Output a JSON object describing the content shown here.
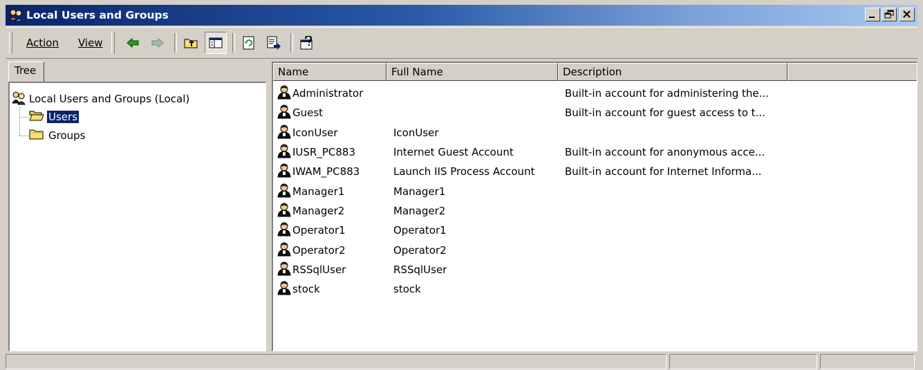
{
  "window": {
    "title": "Local Users and Groups",
    "controls": {
      "minimize": "_",
      "restore": "ø",
      "close": "×"
    }
  },
  "menu": {
    "action": "Action",
    "view": "View"
  },
  "toolbar": {
    "buttons": [
      "back-icon",
      "forward-icon",
      "up-folder-icon",
      "show-hide-tree-icon",
      "refresh-icon",
      "export-list-icon",
      "help-icon"
    ]
  },
  "tree": {
    "tab_label": "Tree",
    "root": "Local Users and Groups (Local)",
    "children": [
      {
        "label": "Users",
        "selected": true
      },
      {
        "label": "Groups",
        "selected": false
      }
    ]
  },
  "list": {
    "columns": [
      "Name",
      "Full Name",
      "Description",
      ""
    ],
    "rows": [
      {
        "name": "Administrator",
        "full_name": "",
        "description": "Built-in account for administering the..."
      },
      {
        "name": "Guest",
        "full_name": "",
        "description": "Built-in account for guest access to t..."
      },
      {
        "name": "IconUser",
        "full_name": "IconUser",
        "description": ""
      },
      {
        "name": "IUSR_PC883",
        "full_name": "Internet Guest Account",
        "description": "Built-in account for anonymous acce..."
      },
      {
        "name": "IWAM_PC883",
        "full_name": "Launch IIS Process Account",
        "description": "Built-in account for Internet Informa..."
      },
      {
        "name": "Manager1",
        "full_name": "Manager1",
        "description": ""
      },
      {
        "name": "Manager2",
        "full_name": "Manager2",
        "description": ""
      },
      {
        "name": "Operator1",
        "full_name": "Operator1",
        "description": ""
      },
      {
        "name": "Operator2",
        "full_name": "Operator2",
        "description": ""
      },
      {
        "name": "RSSqlUser",
        "full_name": "RSSqlUser",
        "description": ""
      },
      {
        "name": "stock",
        "full_name": "stock",
        "description": ""
      }
    ]
  },
  "colors": {
    "titlebar_start": "#0a246a",
    "titlebar_end": "#a6caf0",
    "face": "#d4d0c8",
    "selection": "#0a246a"
  }
}
